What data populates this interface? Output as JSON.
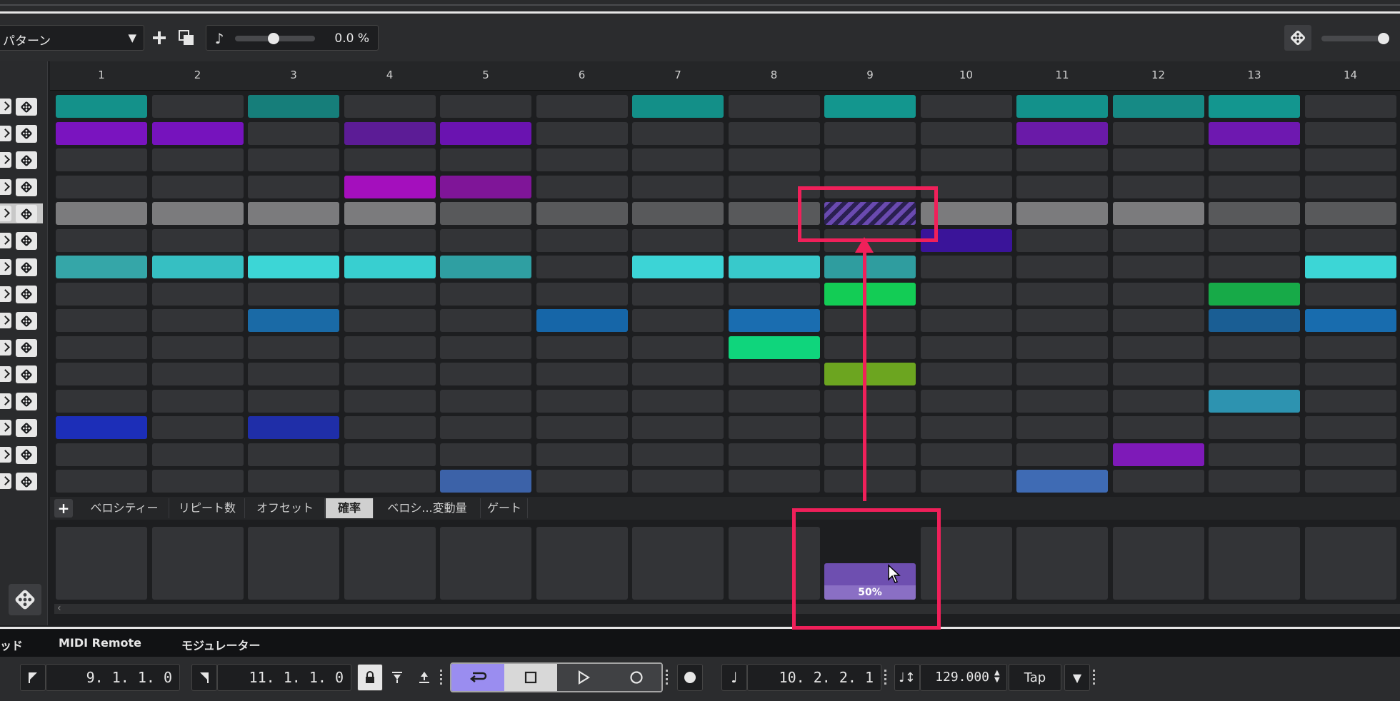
{
  "toolbar": {
    "pattern_label": "パターン",
    "swing_value": "0.0 %",
    "swing_fraction": 0.48,
    "right_slider_fraction": 0.95
  },
  "ruler": {
    "steps": [
      "1",
      "2",
      "3",
      "4",
      "5",
      "6",
      "7",
      "8",
      "9",
      "10",
      "11",
      "12",
      "13",
      "14"
    ]
  },
  "grid": {
    "rows": [
      {
        "cells": {
          "0": "#14918a",
          "2": "#167e7a",
          "6": "#138f88",
          "8": "#13968e",
          "10": "#13918b",
          "11": "#168a85",
          "12": "#13968f"
        }
      },
      {
        "cells": {
          "0": "#7a14bf",
          "1": "#7613bd",
          "3": "#5c1c96",
          "4": "#6a13b0",
          "10": "#6a1aa8",
          "12": "#6e18b0"
        }
      },
      {
        "cells": {}
      },
      {
        "cells": {
          "3": "#a40fbd",
          "4": "#7f1598"
        }
      },
      {
        "cells": {
          "0": "#7b7b7d",
          "1": "#7b7b7d",
          "2": "#7b7b7d",
          "3": "#7b7b7d",
          "4": "#58595b",
          "5": "#58595b",
          "6": "#58595b",
          "7": "#58595b",
          "9": "#7b7b7d",
          "10": "#7b7b7d",
          "11": "#7b7b7d",
          "12": "#58595b",
          "13": "#58595b"
        },
        "hatched": 8
      },
      {
        "cells": {
          "9": "#3a1499"
        }
      },
      {
        "cells": {
          "0": "#35a6a8",
          "1": "#36bfc2",
          "2": "#3cd6d6",
          "3": "#38cfd0",
          "4": "#2f9fa2",
          "6": "#3cd4d6",
          "7": "#38c9cb",
          "8": "#2f9d9f",
          "13": "#3cd6d6"
        }
      },
      {
        "cells": {
          "8": "#13cc55",
          "12": "#17aa48"
        }
      },
      {
        "cells": {
          "2": "#1a6aa6",
          "5": "#1666a8",
          "7": "#1a6db0",
          "12": "#1a5e94",
          "13": "#186cae"
        }
      },
      {
        "cells": {
          "7": "#0fd57c"
        }
      },
      {
        "cells": {
          "8": "#6ca520"
        }
      },
      {
        "cells": {
          "12": "#2d93b0"
        }
      },
      {
        "cells": {
          "0": "#1c2eb8",
          "2": "#1f2ea8"
        }
      },
      {
        "cells": {
          "11": "#7e1ab8"
        }
      },
      {
        "cells": {
          "4": "#3c62a8",
          "10": "#3f6bb4"
        }
      }
    ]
  },
  "tabs": [
    {
      "label": "ベロシティー"
    },
    {
      "label": "リピート数"
    },
    {
      "label": "オフセット"
    },
    {
      "label": "確率",
      "active": true
    },
    {
      "label": "ベロシ...変動量"
    },
    {
      "label": "ゲート"
    }
  ],
  "lane": {
    "selected_step": 8,
    "probability_label": "50%",
    "probability_value": 0.5
  },
  "bottom_tabs": {
    "t0": "ッド",
    "t1": "MIDI Remote",
    "t2": "モジュレーター"
  },
  "transport": {
    "left_locator": "9. 1. 1.   0",
    "right_locator": "11. 1. 1.   0",
    "position": "10. 2. 2.   1",
    "tempo": "129.000",
    "tap_label": "Tap"
  },
  "colors": {
    "highlight": "#f0205a",
    "cycle_active": "#9a8df0"
  }
}
